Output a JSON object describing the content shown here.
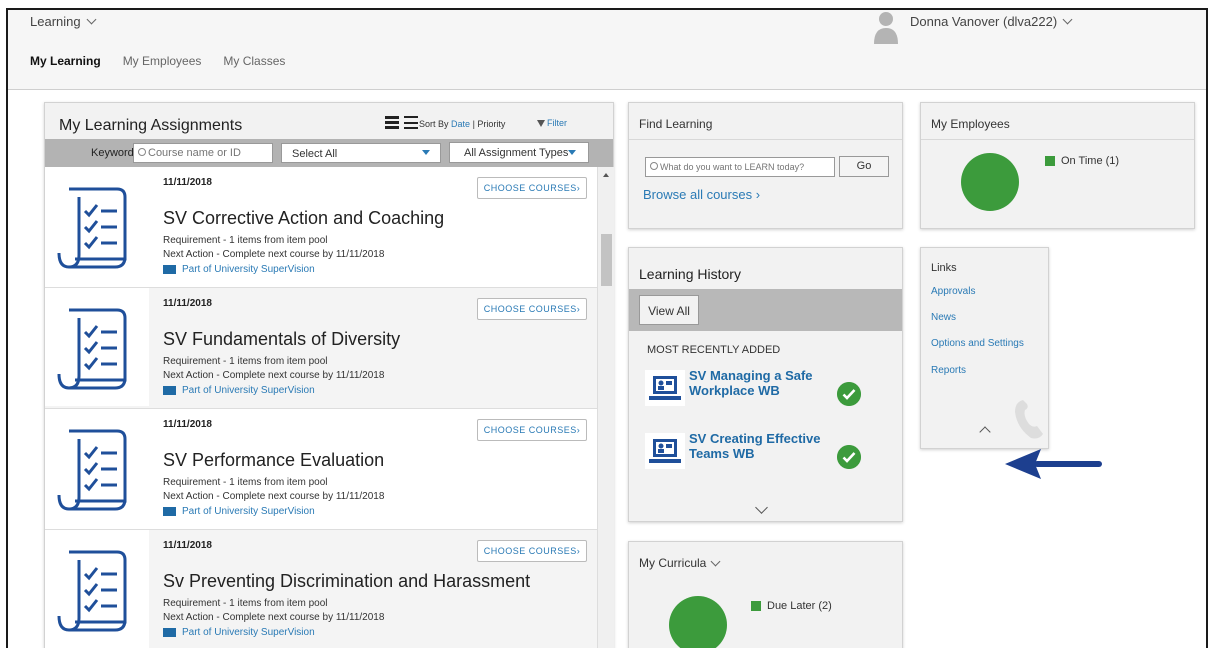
{
  "header": {
    "app_switcher": "Learning",
    "user": "Donna Vanover (dlva222)",
    "tabs": [
      {
        "label": "My Learning",
        "active": true
      },
      {
        "label": "My Employees",
        "active": false
      },
      {
        "label": "My Classes",
        "active": false
      }
    ]
  },
  "assignments": {
    "title": "My Learning Assignments",
    "sort_by_prefix": "Sort By",
    "sort_date": "Date",
    "sort_sep": "|",
    "sort_priority": "Priority",
    "filter": "Filter",
    "keyword_label": "Keyword",
    "keyword_placeholder": "Course name or ID",
    "select_all": "Select All",
    "assignment_types": "All Assignment Types",
    "items": [
      {
        "date": "11/11/2018",
        "title": "SV Corrective Action and Coaching",
        "requirement": "Requirement - 1 items from item pool",
        "next_action": "Next Action - Complete next course by 11/11/2018",
        "part_of": "Part of University SuperVision",
        "button": "CHOOSE COURSES"
      },
      {
        "date": "11/11/2018",
        "title": "SV Fundamentals of Diversity",
        "requirement": "Requirement - 1 items from item pool",
        "next_action": "Next Action - Complete next course by 11/11/2018",
        "part_of": "Part of University SuperVision",
        "button": "CHOOSE COURSES"
      },
      {
        "date": "11/11/2018",
        "title": "SV Performance Evaluation",
        "requirement": "Requirement - 1 items from item pool",
        "next_action": "Next Action - Complete next course by 11/11/2018",
        "part_of": "Part of University SuperVision",
        "button": "CHOOSE COURSES"
      },
      {
        "date": "11/11/2018",
        "title": "Sv Preventing Discrimination and Harassment",
        "requirement": "Requirement - 1 items from item pool",
        "next_action": "Next Action - Complete next course by 11/11/2018",
        "part_of": "Part of University SuperVision",
        "button": "CHOOSE COURSES"
      }
    ]
  },
  "find_learning": {
    "title": "Find Learning",
    "search_placeholder": "What do you want to LEARN today?",
    "go": "Go",
    "browse": "Browse all courses"
  },
  "learning_history": {
    "title": "Learning History",
    "view_all": "View All",
    "subtitle": "MOST RECENTLY ADDED",
    "items": [
      {
        "title": "SV Managing a Safe Workplace WB"
      },
      {
        "title": "SV Creating Effective Teams WB"
      }
    ]
  },
  "my_curricula": {
    "title": "My Curricula",
    "legend": "Due Later (2)"
  },
  "my_employees": {
    "title": "My Employees",
    "legend": "On Time (1)"
  },
  "links": {
    "title": "Links",
    "items": [
      "Approvals",
      "News",
      "Options and Settings",
      "Reports"
    ]
  },
  "colors": {
    "accent_link": "#2a7ab5",
    "status_green": "#3c9b3c",
    "annotation_arrow": "#1d3f8f"
  }
}
